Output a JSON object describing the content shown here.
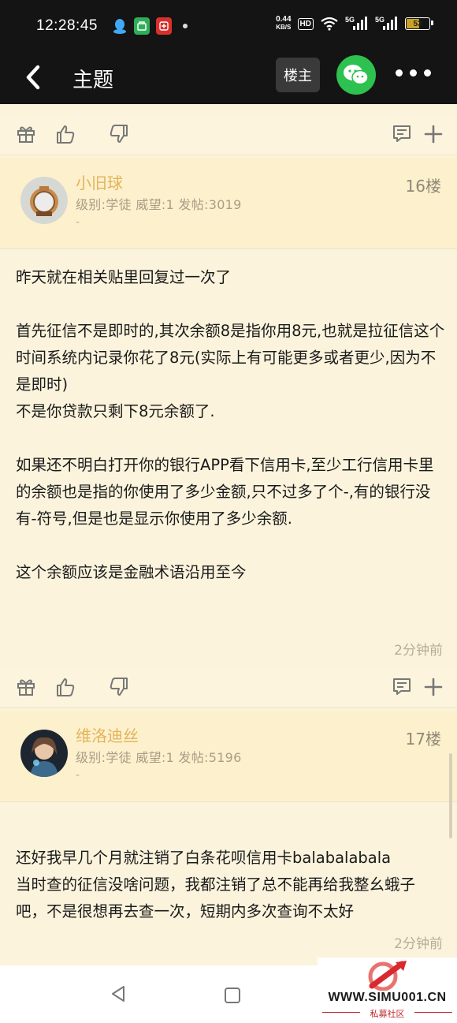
{
  "status_bar": {
    "time": "12:28:45",
    "net_speed_value": "0.44",
    "net_speed_unit": "KB/S",
    "hd_label": "HD",
    "sim1_label": "5G",
    "sim2_label": "5G",
    "battery": "53",
    "app_icons": [
      "qq-icon",
      "wallet-icon",
      "taobao-icon"
    ]
  },
  "header": {
    "title": "主题",
    "op_button": "楼主",
    "share_icon": "wechat-icon",
    "more_icon": "more-icon"
  },
  "posts": [
    {
      "username": "小旧球",
      "stats": "级别:学徒 威望:1 发帖:3019",
      "dash": "-",
      "floor": "16楼",
      "paragraphs": [
        "昨天就在相关贴里回复过一次了",
        "首先征信不是即时的,其次余额8是指你用8元,也就是拉征信这个时间系统内记录你花了8元(实际上有可能更多或者更少,因为不是即时)\n不是你贷款只剩下8元余额了.",
        "如果还不明白打开你的银行APP看下信用卡,至少工行信用卡里的余额也是指的你使用了多少金额,只不过多了个-,有的银行没有-符号,但是也是显示你使用了多少余额.",
        "这个余额应该是金融术语沿用至今"
      ],
      "time": "2分钟前"
    },
    {
      "username": "维洛迪丝",
      "stats": "级别:学徒 威望:1 发帖:5196",
      "dash": "-",
      "floor": "17楼",
      "paragraphs": [
        "还好我早几个月就注销了白条花呗信用卡balabalabala\n当时查的征信没啥问题，我都注销了总不能再给我整幺蛾子吧，不是很想再去查一次，短期内多次查询不太好"
      ],
      "time": "2分钟前"
    }
  ],
  "action_icons": [
    "gift-icon",
    "thumbs-up-icon",
    "thumbs-down-icon",
    "comment-icon",
    "plus-icon"
  ],
  "watermark": {
    "site": "WWW.SIMU001.CN",
    "sub": "私募社区"
  },
  "colors": {
    "username": "#e2b45a",
    "background": "#fbf3dc",
    "header_bg": "#141414",
    "wechat": "#2dc14f",
    "watermark_red": "#c2272d"
  }
}
